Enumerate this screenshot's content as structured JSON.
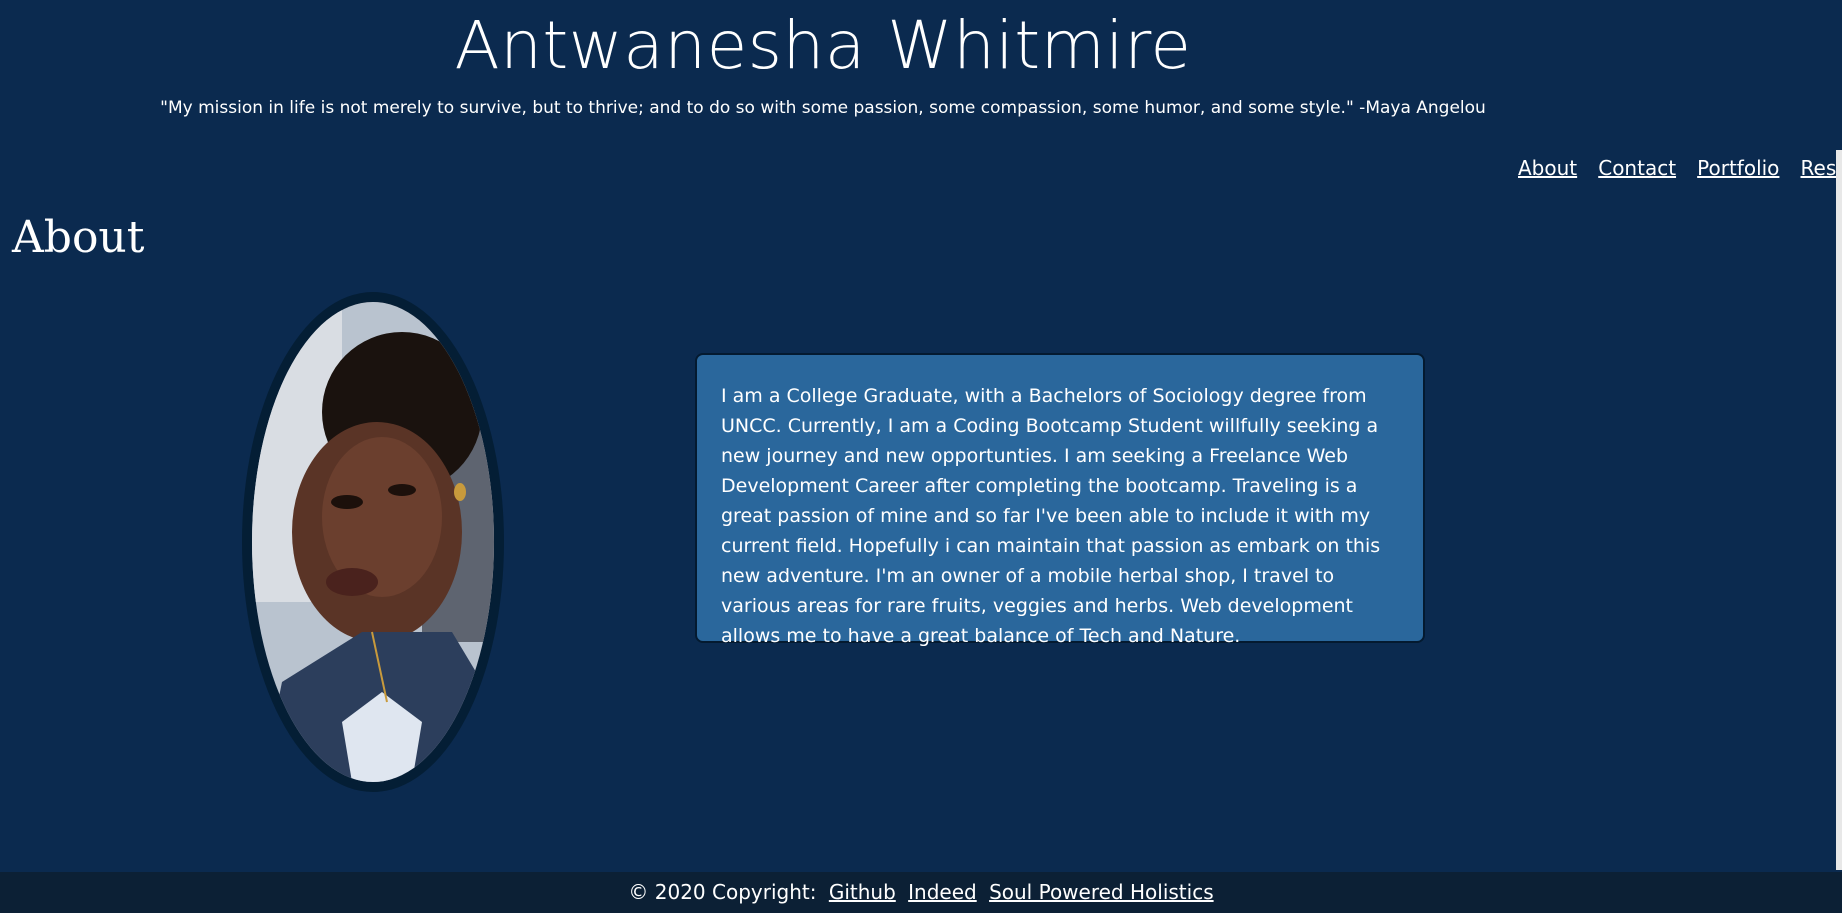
{
  "header": {
    "title": "Antwanesha Whitmire",
    "quote": "\"My mission in life is not merely to survive, but to thrive; and to do so with some passion, some compassion, some humor, and some style.\" -Maya Angelou"
  },
  "nav": {
    "items": [
      {
        "label": "About"
      },
      {
        "label": "Contact"
      },
      {
        "label": "Portfolio"
      },
      {
        "label": "Resume"
      }
    ]
  },
  "about": {
    "heading": "About",
    "photo_icon": "portrait-photo",
    "bio": "I am a College Graduate, with a Bachelors of Sociology degree from UNCC. Currently, I am a Coding Bootcamp Student willfully seeking a new journey and new opportunties. I am seeking a Freelance Web Development Career after completing the bootcamp. Traveling is a great passion of mine and so far I've been able to include it with my current field. Hopefully i can maintain that passion as embark on this new adventure. I'm an owner of a mobile herbal shop, I travel to various areas for rare fruits, veggies and herbs. Web development allows me to have a great balance of Tech and Nature."
  },
  "footer": {
    "copyright": "© 2020 Copyright:",
    "links": [
      {
        "label": "Github"
      },
      {
        "label": "Indeed"
      },
      {
        "label": "Soul Powered Holistics"
      }
    ]
  },
  "colors": {
    "background": "#0b2a4f",
    "card": "#2a679c",
    "footer": "#0c2035"
  }
}
